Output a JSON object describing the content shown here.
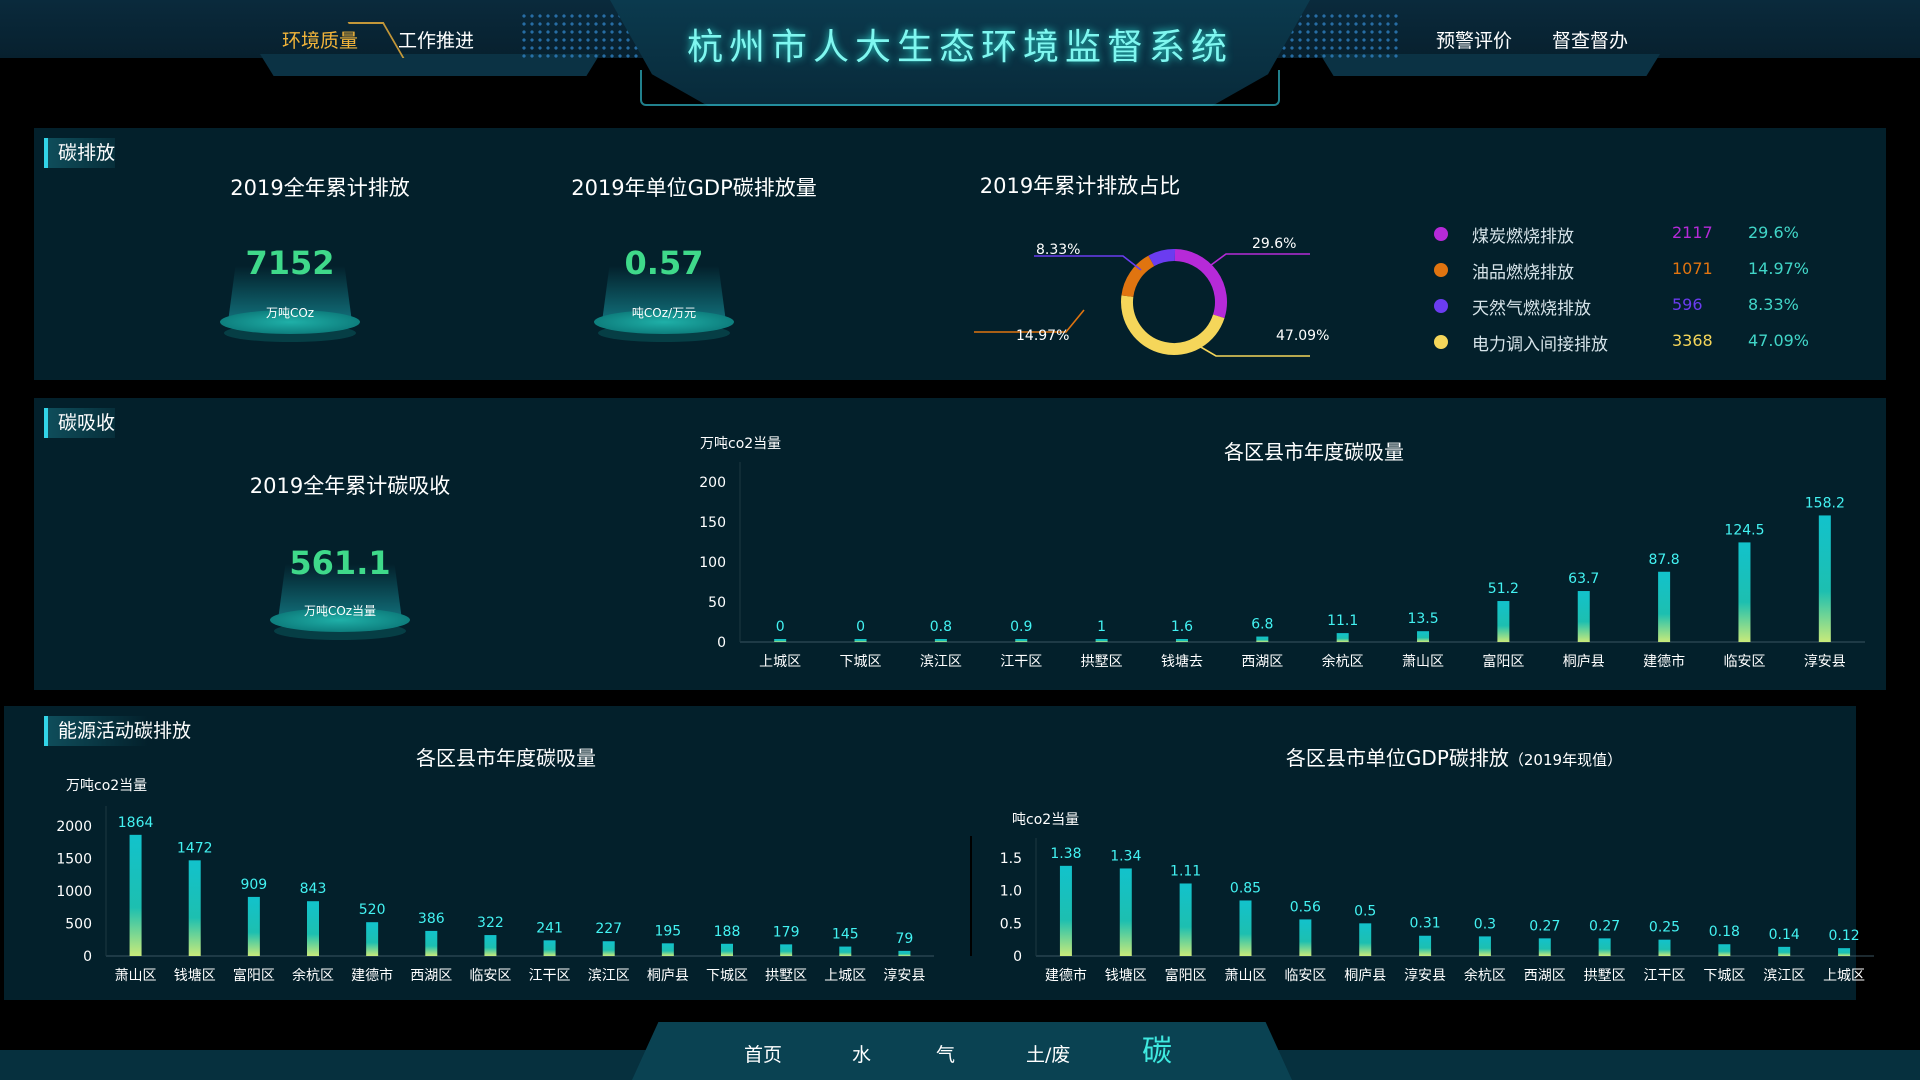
{
  "header": {
    "title": "杭州市人大生态环境监督系统",
    "nav_left": [
      "环境质量",
      "工作推进"
    ],
    "nav_right": [
      "预警评价",
      "督查督办"
    ]
  },
  "emission": {
    "section_title": "碳排放",
    "total_title": "2019全年累计排放",
    "total_value": "7152",
    "total_unit": "万吨COz",
    "gdp_title": "2019年单位GDP碳排放量",
    "gdp_value": "0.57",
    "gdp_unit": "吨COz/万元",
    "donut_title": "2019年累计排放占比",
    "donut_labels": [
      "8.33%",
      "29.6%",
      "14.97%",
      "47.09%"
    ],
    "legend": [
      {
        "name": "煤炭燃烧排放",
        "value": "2117",
        "pct": "29.6%",
        "color": "#b62ad8"
      },
      {
        "name": "油品燃烧排放",
        "value": "1071",
        "pct": "14.97%",
        "color": "#e07410"
      },
      {
        "name": "天然气燃烧排放",
        "value": "596",
        "pct": "8.33%",
        "color": "#6b3cf0"
      },
      {
        "name": "电力调入间接排放",
        "value": "3368",
        "pct": "47.09%",
        "color": "#f5d65a"
      }
    ],
    "pct_color": "#41d6c8"
  },
  "absorption": {
    "section_title": "碳吸收",
    "total_title": "2019全年累计碳吸收",
    "total_value": "561.1",
    "total_unit": "万吨COz当量"
  },
  "energy": {
    "section_title": "能源活动碳排放"
  },
  "chart_data": [
    {
      "type": "bar",
      "title": "各区县市年度碳吸量",
      "ylabel": "万吨co2当量",
      "ylim": [
        0,
        200
      ],
      "yticks": [
        "0",
        "50",
        "100",
        "150",
        "200"
      ],
      "categories": [
        "上城区",
        "下城区",
        "滨江区",
        "江干区",
        "拱墅区",
        "钱塘去",
        "西湖区",
        "余杭区",
        "萧山区",
        "富阳区",
        "桐庐县",
        "建德市",
        "临安区",
        "淳安县"
      ],
      "values": [
        0,
        0,
        0.8,
        0.9,
        1,
        1.6,
        6.8,
        11.1,
        13.5,
        51.2,
        63.7,
        87.8,
        124.5,
        158.2
      ]
    },
    {
      "type": "bar",
      "title": "各区县市年度碳吸量",
      "ylabel": "万吨co2当量",
      "ylim": [
        0,
        2000
      ],
      "yticks": [
        "0",
        "500",
        "1000",
        "1500",
        "2000"
      ],
      "categories": [
        "萧山区",
        "钱塘区",
        "富阳区",
        "余杭区",
        "建德市",
        "西湖区",
        "临安区",
        "江干区",
        "滨江区",
        "桐庐县",
        "下城区",
        "拱墅区",
        "上城区",
        "淳安县"
      ],
      "values": [
        1864,
        1472,
        909,
        843,
        520,
        386,
        322,
        241,
        227,
        195,
        188,
        179,
        145,
        79
      ]
    },
    {
      "type": "bar",
      "title": "各区县市单位GDP碳排放",
      "subtitle": "（2019年现值）",
      "ylabel": "吨co2当量",
      "ylim": [
        0,
        1.5
      ],
      "yticks": [
        "0",
        "0.5",
        "1.0",
        "1.5"
      ],
      "categories": [
        "建德市",
        "钱塘区",
        "富阳区",
        "萧山区",
        "临安区",
        "桐庐县",
        "淳安县",
        "余杭区",
        "西湖区",
        "拱墅区",
        "江干区",
        "下城区",
        "滨江区",
        "上城区"
      ],
      "values": [
        1.38,
        1.34,
        1.11,
        0.85,
        0.56,
        0.5,
        0.31,
        0.3,
        0.27,
        0.27,
        0.25,
        0.18,
        0.14,
        0.12
      ]
    }
  ],
  "footer": {
    "nav": [
      "首页",
      "水",
      "气",
      "土/废",
      "碳"
    ]
  }
}
